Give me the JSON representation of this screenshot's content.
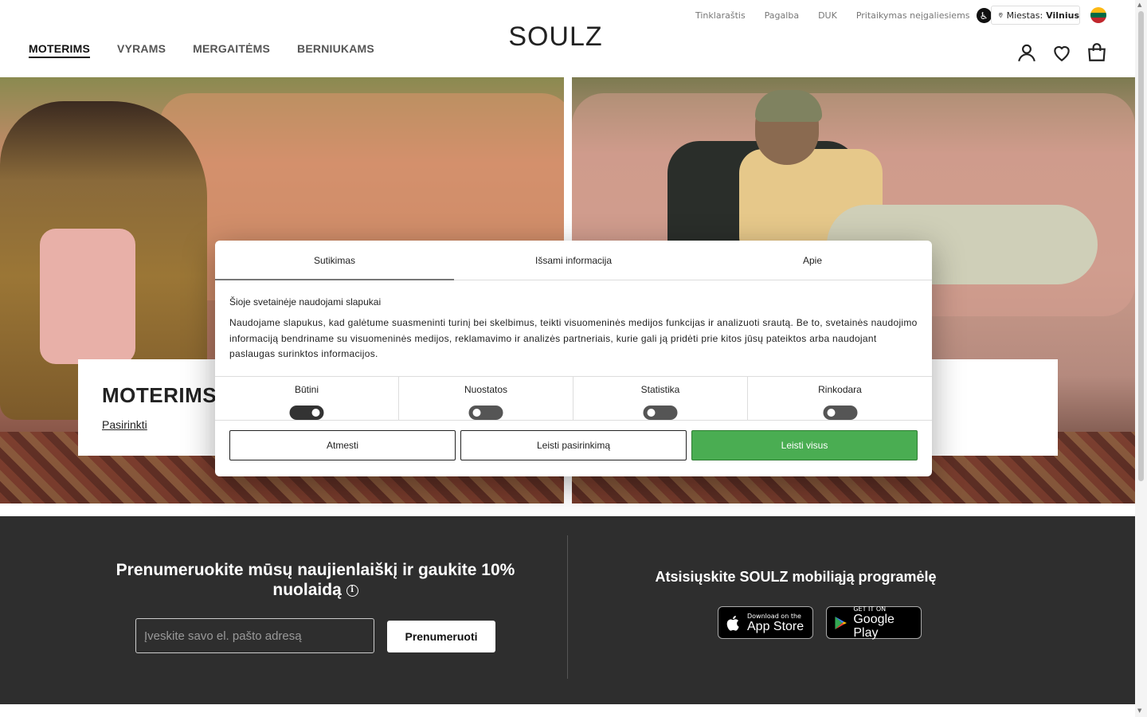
{
  "header": {
    "top_links": [
      "Tinklaraštis",
      "Pagalba",
      "DUK",
      "Pritaikymas neįgaliesiems"
    ],
    "city_label": "Miestas:",
    "city_value": "Vilnius",
    "logo": "SOULZ",
    "nav": [
      "MOTERIMS",
      "VYRAMS",
      "MERGAITĖMS",
      "BERNIUKAMS"
    ],
    "flag_colors": [
      "#fdb913",
      "#006a44",
      "#c1272d"
    ]
  },
  "hero": {
    "left": {
      "title": "MOTERIMS",
      "link": "Pasirinkti"
    }
  },
  "cookie": {
    "tabs": [
      "Sutikimas",
      "Išsami informacija",
      "Apie"
    ],
    "heading": "Šioje svetainėje naudojami slapukai",
    "text": "Naudojame slapukus, kad galėtume suasmeninti turinį bei skelbimus, teikti visuomeninės medijos funkcijas ir analizuoti srautą. Be to, svetainės naudojimo informaciją bendriname su visuomeninės medijos, reklamavimo ir analizės partneriais, kurie gali ją pridėti prie kitos jūsų pateiktos arba naudojant paslaugas surinktos informacijos.",
    "categories": [
      "Būtini",
      "Nuostatos",
      "Statistika",
      "Rinkodara"
    ],
    "buttons": {
      "reject": "Atmesti",
      "allow_selection": "Leisti pasirinkimą",
      "allow_all": "Leisti visus"
    },
    "accent_color": "#4aad52"
  },
  "footer": {
    "newsletter_title": "Prenumeruokite mūsų naujienlaiškį ir gaukite 10% nuolaidą",
    "email_placeholder": "Įveskite savo el. pašto adresą",
    "subscribe_button": "Prenumeruoti",
    "app_title": "Atsisiųskite SOULZ mobiliąją programėlę",
    "app_store": {
      "small": "Download on the",
      "big": "App Store"
    },
    "google_play": {
      "small": "GET IT ON",
      "big": "Google Play"
    }
  }
}
